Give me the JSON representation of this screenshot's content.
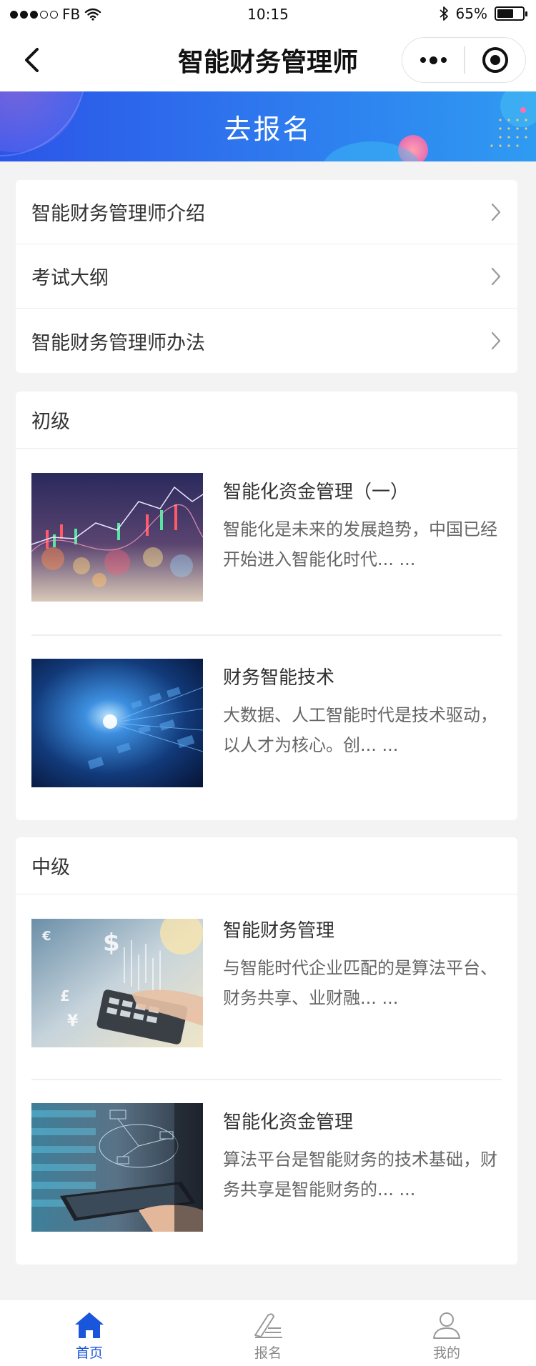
{
  "status_bar": {
    "carrier": "FB",
    "time": "10:15",
    "battery": "65%",
    "battery_level": 0.65
  },
  "nav": {
    "title": "智能财务管理师"
  },
  "banner": {
    "title": "去报名"
  },
  "links": [
    {
      "label": "智能财务管理师介绍"
    },
    {
      "label": "考试大纲"
    },
    {
      "label": "智能财务管理师办法"
    }
  ],
  "sections": [
    {
      "title": "初级",
      "articles": [
        {
          "title": "智能化资金管理（一）",
          "desc": "智能化是未来的发展趋势，中国已经开始进入智能化时代... ..."
        },
        {
          "title": "财务智能技术",
          "desc": "大数据、人工智能时代是技术驱动，以人才为核心。创... ..."
        }
      ]
    },
    {
      "title": "中级",
      "articles": [
        {
          "title": "智能财务管理",
          "desc": "与智能时代企业匹配的是算法平台、财务共享、业财融... ..."
        },
        {
          "title": "智能化资金管理",
          "desc": "算法平台是智能财务的技术基础，财务共享是智能财务的... ..."
        }
      ]
    }
  ],
  "tabs": [
    {
      "label": "首页",
      "icon": "home-icon",
      "active": true
    },
    {
      "label": "报名",
      "icon": "edit-icon",
      "active": false
    },
    {
      "label": "我的",
      "icon": "user-icon",
      "active": false
    }
  ],
  "colors": {
    "accent": "#1a56db",
    "banner_start": "#2b55e8",
    "banner_end": "#2f9bf2"
  }
}
